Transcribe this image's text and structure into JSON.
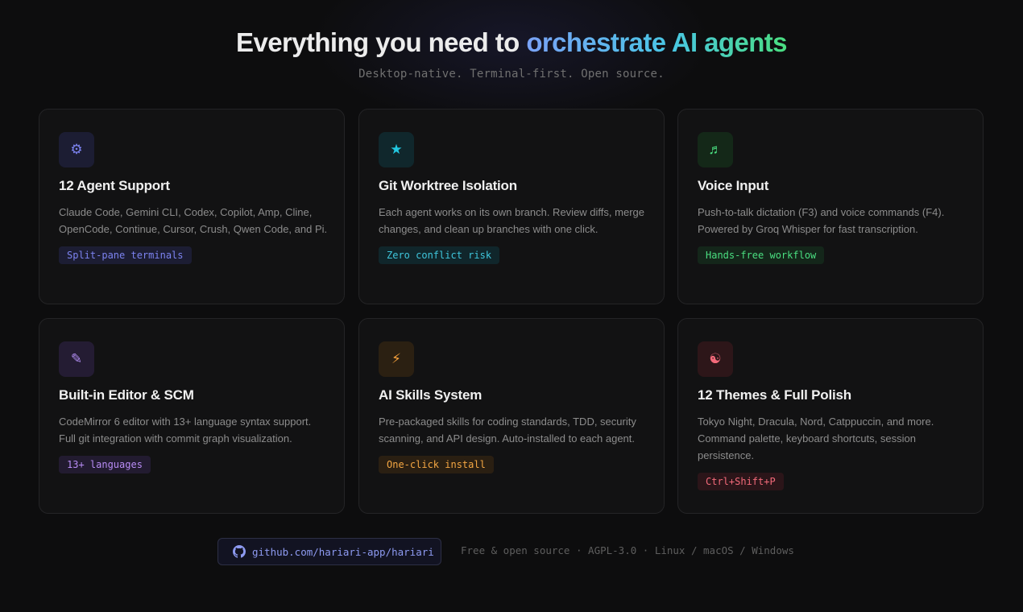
{
  "hero": {
    "title_plain": "Everything you need to ",
    "title_gradient": "orchestrate AI agents",
    "subtitle": "Desktop-native. Terminal-first. Open source."
  },
  "features": [
    {
      "icon": "gear-icon",
      "icon_glyph": "⚙",
      "accent": "#7c83f0",
      "icon_bg": "#1c1d33",
      "title": "12 Agent Support",
      "description": "Claude Code, Gemini CLI, Codex, Copilot, Amp, Cline, OpenCode, Continue, Cursor, Crush, Qwen Code, and Pi.",
      "tag": "Split-pane terminals",
      "tag_color": "#7c83f0",
      "tag_bg": "#1c1d33"
    },
    {
      "icon": "star-icon",
      "icon_glyph": "★",
      "accent": "#22c7e0",
      "icon_bg": "#10272c",
      "title": "Git Worktree Isolation",
      "description": "Each agent works on its own branch. Review diffs, merge changes, and clean up branches with one click.",
      "tag": "Zero conflict risk",
      "tag_color": "#3fc6dc",
      "tag_bg": "#10262b"
    },
    {
      "icon": "music-note-icon",
      "icon_glyph": "♬",
      "accent": "#4ade80",
      "icon_bg": "#142818",
      "title": "Voice Input",
      "description": "Push-to-talk dictation (F3) and voice commands (F4). Powered by Groq Whisper for fast transcription.",
      "tag": "Hands-free workflow",
      "tag_color": "#4ade80",
      "tag_bg": "#14261a"
    },
    {
      "icon": "pencil-icon",
      "icon_glyph": "✎",
      "accent": "#b08cf0",
      "icon_bg": "#241c33",
      "title": "Built-in Editor & SCM",
      "description": "CodeMirror 6 editor with 13+ language syntax support. Full git integration with commit graph visualization.",
      "tag": "13+ languages",
      "tag_color": "#b88cf5",
      "tag_bg": "#221b30"
    },
    {
      "icon": "lightning-icon",
      "icon_glyph": "⚡",
      "accent": "#f5a03c",
      "icon_bg": "#2b2012",
      "title": "AI Skills System",
      "description": "Pre-packaged skills for coding standards, TDD, security scanning, and API design. Auto-installed to each agent.",
      "tag": "One-click install",
      "tag_color": "#f5a743",
      "tag_bg": "#2a1f12"
    },
    {
      "icon": "palette-icon",
      "icon_glyph": "☯",
      "accent": "#f36a7a",
      "icon_bg": "#2d1619",
      "title": "12 Themes & Full Polish",
      "description": "Tokyo Night, Dracula, Nord, Catppuccin, and more. Command palette, keyboard shortcuts, session persistence.",
      "tag": "Ctrl+Shift+P",
      "tag_color": "#f36a7a",
      "tag_bg": "#2b1519"
    }
  ],
  "footer": {
    "repo_link": "github.com/hariari-app/hariari",
    "meta": "Free & open source · AGPL-3.0 · Linux / macOS / Windows"
  }
}
